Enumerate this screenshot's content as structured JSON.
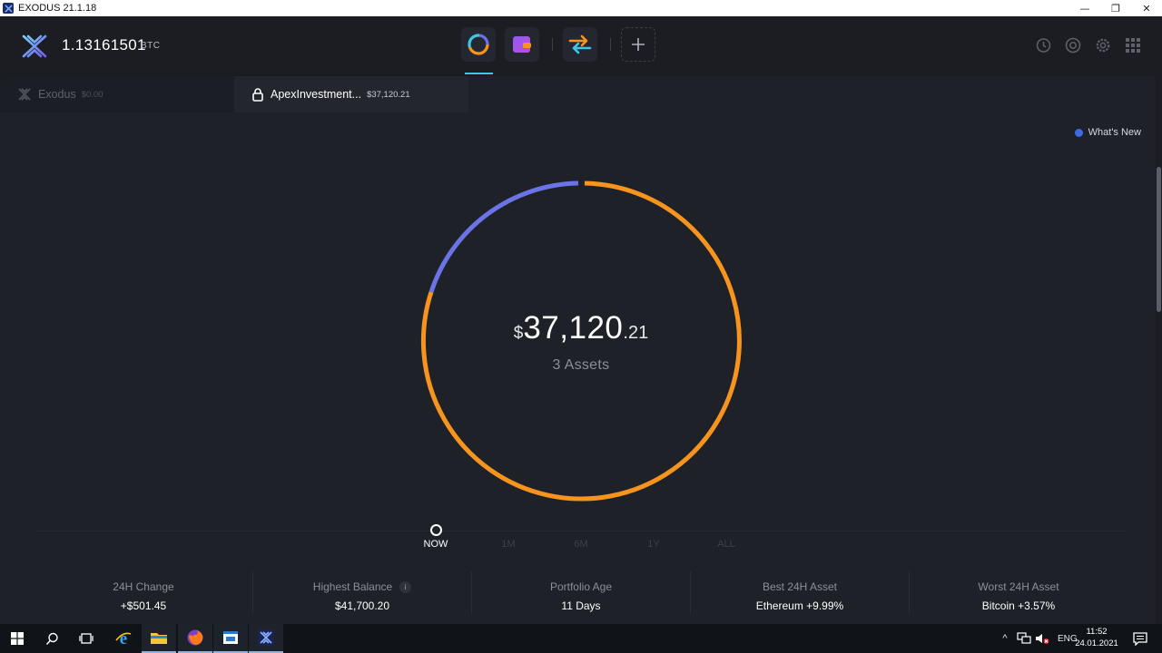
{
  "window": {
    "title": "EXODUS 21.1.18",
    "min_glyph": "—",
    "max_glyph": "❐",
    "close_glyph": "✕"
  },
  "header": {
    "btc_balance": "1.13161501",
    "btc_unit": "BTC",
    "nav": [
      {
        "name": "portfolio",
        "icon": "donut-chart-icon"
      },
      {
        "name": "wallet",
        "icon": "wallet-icon"
      },
      {
        "name": "exchange",
        "icon": "exchange-arrows-icon"
      },
      {
        "name": "add",
        "icon": "plus-icon"
      }
    ],
    "right_icons": [
      "history-icon",
      "help-lifebuoy-icon",
      "settings-gear-icon",
      "apps-grid-icon"
    ]
  },
  "portfolios": [
    {
      "name": "Exodus",
      "amount": "$0.00"
    },
    {
      "name": "ApexInvestment...",
      "amount": "$37,120.21"
    }
  ],
  "whats_new": "What's New",
  "total": {
    "symbol": "$",
    "integer": "37,120",
    "decimal": ".21"
  },
  "assets_label": "3 Assets",
  "colors": {
    "orange": "#f7941d",
    "purple": "#6b74e6",
    "accent": "#3cc7e8",
    "blue_dot": "#3d6be8"
  },
  "time_ranges": [
    "NOW",
    "1M",
    "6M",
    "1Y",
    "ALL"
  ],
  "active_range": "NOW",
  "stats": [
    {
      "label": "24H Change",
      "value": "+$501.45"
    },
    {
      "label": "Highest Balance",
      "value": "$41,700.20",
      "info": "i"
    },
    {
      "label": "Portfolio Age",
      "value": "11 Days"
    },
    {
      "label": "Best 24H Asset",
      "value": "Ethereum +9.99%"
    },
    {
      "label": "Worst 24H Asset",
      "value": "Bitcoin +3.57%"
    }
  ],
  "taskbar": {
    "lang": "ENG",
    "time": "11:52",
    "date": "24.01.2021"
  }
}
